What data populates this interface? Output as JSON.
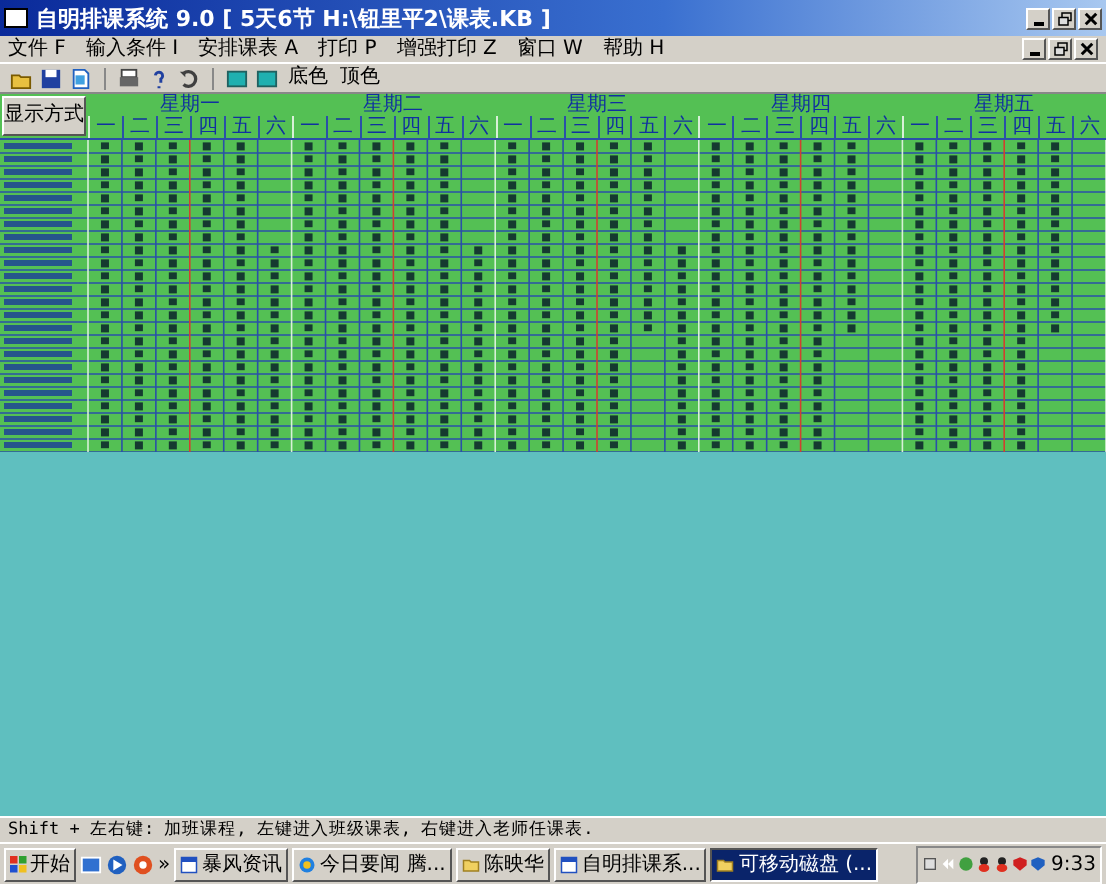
{
  "window": {
    "title": "自明排课系统 9.0 [ 5天6节 H:\\钮里平2\\课表.KB ]"
  },
  "menu": [
    {
      "label": "文件 F"
    },
    {
      "label": "输入条件 I"
    },
    {
      "label": "安排课表 A"
    },
    {
      "label": "打印 P"
    },
    {
      "label": "增强打印 Z"
    },
    {
      "label": "窗口 W"
    },
    {
      "label": "帮助 H"
    }
  ],
  "toolbar": {
    "labels": [
      "底色",
      "顶色"
    ]
  },
  "table": {
    "corner_button": "显示方式",
    "days": [
      {
        "label": "星期一",
        "periods": [
          "一",
          "二",
          "三",
          "四",
          "五",
          "六"
        ]
      },
      {
        "label": "星期二",
        "periods": [
          "一",
          "二",
          "三",
          "四",
          "五",
          "六"
        ]
      },
      {
        "label": "星期三",
        "periods": [
          "一",
          "二",
          "三",
          "四",
          "五",
          "六"
        ]
      },
      {
        "label": "星期四",
        "periods": [
          "一",
          "二",
          "三",
          "四",
          "五",
          "六"
        ]
      },
      {
        "label": "星期五",
        "periods": [
          "一",
          "二",
          "三",
          "四",
          "五",
          "六"
        ]
      }
    ]
  },
  "status_bar": "Shift + 左右键: 加班课程, 左键进入班级课表, 右键进入老师任课表.",
  "taskbar": {
    "start": "开始",
    "chevron": "»",
    "tasks": [
      {
        "label": "暴风资讯",
        "kind": "app",
        "selected": false
      },
      {
        "label": "今日要闻 腾...",
        "kind": "browser",
        "selected": false
      },
      {
        "label": "陈映华",
        "kind": "folder",
        "selected": false
      },
      {
        "label": "自明排课系...",
        "kind": "app",
        "selected": false
      },
      {
        "label": "可移动磁盘 (...",
        "kind": "folder",
        "selected": true
      }
    ],
    "clock": "9:33"
  }
}
